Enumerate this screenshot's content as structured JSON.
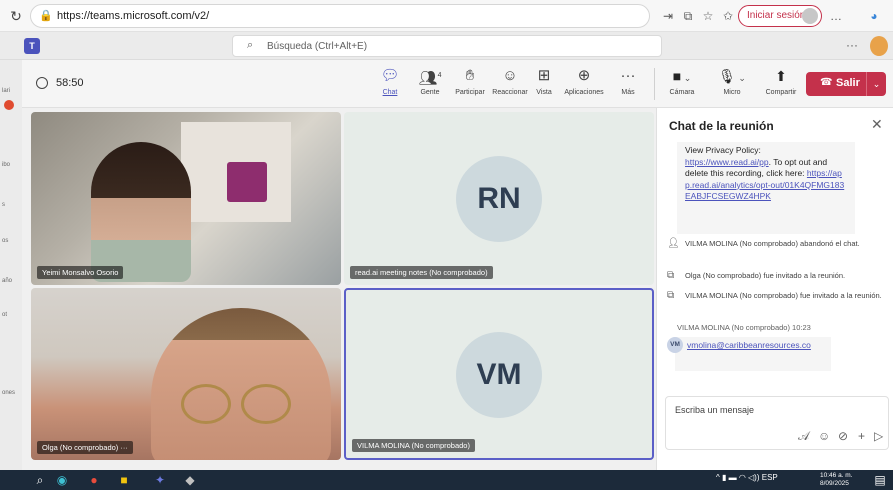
{
  "browser": {
    "url": "https://teams.microsoft.com/v2/",
    "signin_label": "Iniciar sesión"
  },
  "teams": {
    "search_placeholder": "Búsqueda (Ctrl+Alt+E)"
  },
  "left_rail": [
    "lari",
    "ibo",
    "s",
    "os",
    "año",
    "ot",
    "ones"
  ],
  "meeting": {
    "timer": "58:50",
    "toolbar": [
      {
        "label": "Chat",
        "icon": "chat-icon",
        "active": true
      },
      {
        "label": "Gente",
        "icon": "people-icon",
        "badge": "4"
      },
      {
        "label": "Participar",
        "icon": "raise-hand-icon"
      },
      {
        "label": "Reaccionar",
        "icon": "react-icon"
      },
      {
        "label": "Vista",
        "icon": "view-icon"
      },
      {
        "label": "Aplicaciones",
        "icon": "apps-icon"
      },
      {
        "label": "Más",
        "icon": "more-icon"
      }
    ],
    "camera_label": "Cámara",
    "mic_label": "Micro",
    "share_label": "Compartir",
    "leave_label": "Salir"
  },
  "participants": [
    {
      "name": "Yeimi Monsalvo Osorio",
      "type": "video"
    },
    {
      "name": "read.ai meeting notes (No comprobado)",
      "initials": "RN",
      "type": "avatar"
    },
    {
      "name": "Olga (No comprobado)",
      "type": "video"
    },
    {
      "name": "VILMA MOLINA (No comprobado)",
      "initials": "VM",
      "type": "avatar",
      "active_speaker": true
    }
  ],
  "chat": {
    "title": "Chat de la reunión",
    "privacy_msg": {
      "line1": "View Privacy Policy:",
      "link1": "https://www.read.ai/pp",
      "line2": ". To opt out and delete this recording, click here:",
      "link2": "https://app.read.ai/analytics/opt-out/01K4QFMG183EABJFCSEGWZ4HPK"
    },
    "system_messages": [
      {
        "icon": "person-leave-icon",
        "text": "VILMA MOLINA (No comprobado) abandonó el chat."
      },
      {
        "icon": "invite-icon",
        "text": "Olga (No comprobado) fue invitado a la reunión."
      },
      {
        "icon": "invite-icon",
        "text": "VILMA MOLINA (No comprobado) fue invitado a la reunión."
      }
    ],
    "last_sender": "VILMA MOLINA (No comprobado)  10:23",
    "last_sender_initials": "VM",
    "last_message": "vmolina@caribbeanresources.co",
    "compose_placeholder": "Escriba un mensaje"
  },
  "taskbar": {
    "tray_lang": "ESP",
    "time": "10:46 a. m.",
    "date": "8/09/2025"
  },
  "colors": {
    "accent": "#4b53bc",
    "leave": "#c4314b",
    "taskbar": "#1c2a3a"
  }
}
